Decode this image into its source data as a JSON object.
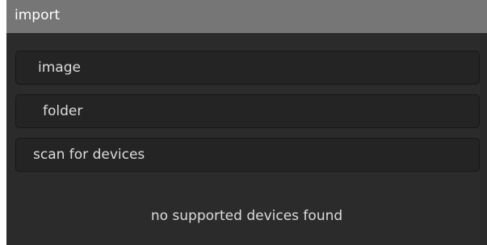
{
  "panel": {
    "title": "import"
  },
  "buttons": {
    "image": "image",
    "folder": "folder",
    "scan": "scan for devices"
  },
  "status": {
    "message": "no supported devices found"
  }
}
